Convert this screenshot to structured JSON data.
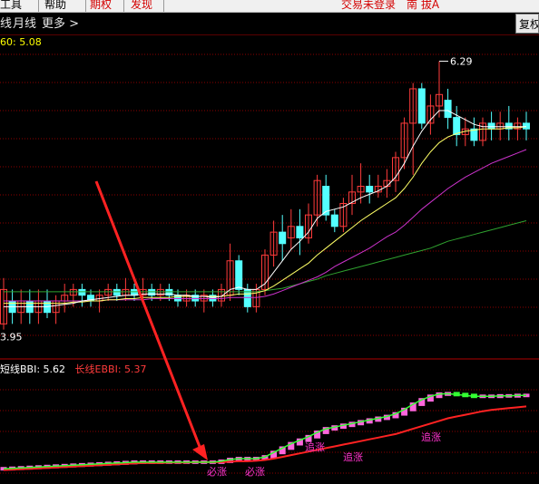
{
  "menu": {
    "items": [
      "工具",
      "帮助"
    ],
    "red_items": [
      "期权",
      "发现"
    ],
    "status_text": "交易未登录",
    "broker": "南 拔A"
  },
  "tabs": {
    "items": [
      "月线",
      "更多 >"
    ],
    "right_button": "复权"
  },
  "main_chart": {
    "ma_label": "60: 5.08",
    "high_label": "6.29",
    "low_label": "3.95"
  },
  "sub_chart": {
    "short_label": "短线BBI: 5.62",
    "long_label": "长线EBBI: 5.37"
  },
  "signals": [
    "必涨",
    "必涨",
    "追涨",
    "追涨",
    "追涨"
  ],
  "colors": {
    "background": "#000000",
    "grid": "#8b0000",
    "up_candle": "#ff3b3b",
    "down_candle": "#54ffff",
    "ma_fast": "#ffffff",
    "ma_mid": "#ffff66",
    "ma_slow": "#cc33cc",
    "ma_long": "#2fa22f",
    "arrow": "#ff2222",
    "signal_text": "#ff33cc"
  },
  "chart_data": {
    "type": "candlestick",
    "y_axis_unit": "price",
    "high_marker": 6.29,
    "low_marker": 3.95,
    "candles": [
      [
        4.0,
        4.3,
        3.95,
        4.4
      ],
      [
        4.2,
        4.1,
        4.0,
        4.3
      ],
      [
        4.1,
        4.2,
        4.0,
        4.3
      ],
      [
        4.2,
        4.1,
        4.0,
        4.3
      ],
      [
        4.1,
        4.2,
        4.0,
        4.3
      ],
      [
        4.2,
        4.1,
        4.05,
        4.3
      ],
      [
        4.1,
        4.2,
        4.0,
        4.25
      ],
      [
        4.2,
        4.25,
        4.1,
        4.35
      ],
      [
        4.25,
        4.3,
        4.15,
        4.35
      ],
      [
        4.3,
        4.25,
        4.15,
        4.35
      ],
      [
        4.25,
        4.2,
        4.15,
        4.3
      ],
      [
        4.2,
        4.25,
        4.1,
        4.3
      ],
      [
        4.25,
        4.3,
        4.2,
        4.35
      ],
      [
        4.3,
        4.25,
        4.2,
        4.35
      ],
      [
        4.25,
        4.3,
        4.2,
        4.4
      ],
      [
        4.3,
        4.25,
        4.2,
        4.35
      ],
      [
        4.25,
        4.3,
        4.2,
        4.4
      ],
      [
        4.3,
        4.25,
        4.2,
        4.35
      ],
      [
        4.25,
        4.3,
        4.2,
        4.35
      ],
      [
        4.3,
        4.25,
        4.2,
        4.35
      ],
      [
        4.25,
        4.2,
        4.15,
        4.3
      ],
      [
        4.2,
        4.25,
        4.15,
        4.3
      ],
      [
        4.25,
        4.2,
        4.15,
        4.3
      ],
      [
        4.2,
        4.25,
        4.1,
        4.3
      ],
      [
        4.25,
        4.2,
        4.15,
        4.3
      ],
      [
        4.2,
        4.3,
        4.15,
        4.35
      ],
      [
        4.25,
        4.55,
        4.2,
        4.7
      ],
      [
        4.55,
        4.3,
        4.25,
        4.6
      ],
      [
        4.3,
        4.15,
        4.1,
        4.35
      ],
      [
        4.15,
        4.3,
        4.1,
        4.35
      ],
      [
        4.3,
        4.6,
        4.25,
        4.65
      ],
      [
        4.6,
        4.8,
        4.5,
        4.9
      ],
      [
        4.8,
        4.7,
        4.55,
        4.95
      ],
      [
        4.75,
        4.85,
        4.65,
        5.0
      ],
      [
        4.85,
        4.75,
        4.6,
        5.0
      ],
      [
        4.75,
        4.95,
        4.7,
        5.05
      ],
      [
        4.95,
        5.25,
        4.85,
        5.3
      ],
      [
        5.2,
        4.95,
        4.9,
        5.3
      ],
      [
        4.95,
        4.85,
        4.8,
        5.0
      ],
      [
        4.85,
        5.05,
        4.8,
        5.1
      ],
      [
        5.05,
        5.15,
        4.95,
        5.3
      ],
      [
        5.15,
        5.2,
        5.05,
        5.4
      ],
      [
        5.2,
        5.15,
        5.05,
        5.3
      ],
      [
        5.15,
        5.2,
        5.1,
        5.3
      ],
      [
        5.2,
        5.25,
        5.1,
        5.35
      ],
      [
        5.25,
        5.45,
        5.15,
        5.5
      ],
      [
        5.45,
        5.75,
        5.35,
        5.8
      ],
      [
        5.75,
        6.05,
        5.3,
        6.1
      ],
      [
        6.05,
        5.75,
        5.7,
        6.1
      ],
      [
        5.75,
        5.9,
        5.65,
        6.0
      ],
      [
        5.9,
        6.0,
        5.8,
        6.29
      ],
      [
        5.95,
        5.8,
        5.7,
        6.05
      ],
      [
        5.8,
        5.65,
        5.55,
        5.9
      ],
      [
        5.65,
        5.7,
        5.55,
        5.8
      ],
      [
        5.7,
        5.6,
        5.55,
        5.8
      ],
      [
        5.6,
        5.75,
        5.55,
        5.8
      ],
      [
        5.75,
        5.7,
        5.6,
        5.85
      ],
      [
        5.7,
        5.75,
        5.6,
        5.85
      ],
      [
        5.75,
        5.7,
        5.6,
        5.9
      ],
      [
        5.7,
        5.75,
        5.6,
        5.8
      ],
      [
        5.75,
        5.7,
        5.6,
        5.85
      ]
    ],
    "ma_fast": [
      4.15,
      4.15,
      4.15,
      4.15,
      4.15,
      4.15,
      4.16,
      4.17,
      4.18,
      4.2,
      4.21,
      4.22,
      4.23,
      4.24,
      4.25,
      4.25,
      4.26,
      4.26,
      4.26,
      4.26,
      4.25,
      4.25,
      4.24,
      4.24,
      4.23,
      4.24,
      4.3,
      4.32,
      4.3,
      4.3,
      4.35,
      4.45,
      4.55,
      4.65,
      4.72,
      4.8,
      4.92,
      4.98,
      5.0,
      5.02,
      5.06,
      5.1,
      5.13,
      5.16,
      5.2,
      5.28,
      5.4,
      5.55,
      5.68,
      5.78,
      5.86,
      5.86,
      5.82,
      5.78,
      5.74,
      5.72,
      5.72,
      5.72,
      5.72,
      5.72,
      5.72
    ],
    "ma_mid": [
      4.18,
      4.18,
      4.18,
      4.18,
      4.18,
      4.18,
      4.18,
      4.18,
      4.19,
      4.19,
      4.2,
      4.2,
      4.21,
      4.21,
      4.22,
      4.22,
      4.23,
      4.23,
      4.23,
      4.23,
      4.24,
      4.24,
      4.24,
      4.24,
      4.24,
      4.24,
      4.25,
      4.26,
      4.26,
      4.27,
      4.29,
      4.33,
      4.38,
      4.43,
      4.48,
      4.53,
      4.6,
      4.66,
      4.72,
      4.78,
      4.84,
      4.9,
      4.95,
      5.0,
      5.05,
      5.1,
      5.18,
      5.28,
      5.4,
      5.5,
      5.58,
      5.63,
      5.66,
      5.68,
      5.69,
      5.7,
      5.7,
      5.7,
      5.71,
      5.71,
      5.72
    ],
    "ma_slow": [
      4.2,
      4.2,
      4.2,
      4.2,
      4.2,
      4.2,
      4.2,
      4.2,
      4.2,
      4.2,
      4.2,
      4.2,
      4.21,
      4.21,
      4.21,
      4.21,
      4.21,
      4.22,
      4.22,
      4.22,
      4.22,
      4.22,
      4.22,
      4.22,
      4.22,
      4.22,
      4.23,
      4.23,
      4.23,
      4.23,
      4.24,
      4.26,
      4.29,
      4.32,
      4.35,
      4.38,
      4.41,
      4.45,
      4.5,
      4.54,
      4.58,
      4.62,
      4.66,
      4.71,
      4.76,
      4.8,
      4.86,
      4.93,
      5.0,
      5.06,
      5.12,
      5.18,
      5.23,
      5.28,
      5.32,
      5.36,
      5.4,
      5.43,
      5.46,
      5.49,
      5.52
    ],
    "ma_long": [
      4.28,
      4.28,
      4.28,
      4.28,
      4.28,
      4.28,
      4.28,
      4.28,
      4.28,
      4.28,
      4.28,
      4.28,
      4.28,
      4.28,
      4.28,
      4.28,
      4.28,
      4.28,
      4.28,
      4.28,
      4.28,
      4.28,
      4.28,
      4.28,
      4.28,
      4.28,
      4.28,
      4.28,
      4.28,
      4.28,
      4.29,
      4.3,
      4.31,
      4.33,
      4.35,
      4.37,
      4.39,
      4.42,
      4.44,
      4.46,
      4.48,
      4.5,
      4.52,
      4.54,
      4.56,
      4.58,
      4.6,
      4.62,
      4.64,
      4.66,
      4.69,
      4.72,
      4.74,
      4.76,
      4.78,
      4.8,
      4.82,
      4.84,
      4.86,
      4.88,
      4.9
    ],
    "bbi_short": [
      3.95,
      3.96,
      3.97,
      3.98,
      3.99,
      4.0,
      4.01,
      4.02,
      4.03,
      4.04,
      4.05,
      4.06,
      4.07,
      4.08,
      4.09,
      4.1,
      4.1,
      4.1,
      4.1,
      4.1,
      4.1,
      4.1,
      4.1,
      4.1,
      4.1,
      4.12,
      4.16,
      4.18,
      4.18,
      4.18,
      4.22,
      4.32,
      4.42,
      4.52,
      4.6,
      4.68,
      4.78,
      4.86,
      4.9,
      4.94,
      4.98,
      5.02,
      5.06,
      5.1,
      5.14,
      5.2,
      5.3,
      5.42,
      5.52,
      5.6,
      5.65,
      5.66,
      5.64,
      5.62,
      5.6,
      5.6,
      5.6,
      5.61,
      5.61,
      5.62,
      5.62
    ],
    "bbi_long": [
      3.92,
      3.93,
      3.94,
      3.95,
      3.96,
      3.97,
      3.98,
      3.99,
      4.0,
      4.01,
      4.02,
      4.03,
      4.04,
      4.05,
      4.06,
      4.07,
      4.08,
      4.08,
      4.08,
      4.09,
      4.09,
      4.09,
      4.1,
      4.1,
      4.1,
      4.1,
      4.11,
      4.12,
      4.12,
      4.13,
      4.15,
      4.18,
      4.22,
      4.26,
      4.3,
      4.34,
      4.38,
      4.42,
      4.46,
      4.5,
      4.54,
      4.58,
      4.62,
      4.66,
      4.7,
      4.74,
      4.8,
      4.86,
      4.92,
      4.98,
      5.04,
      5.1,
      5.14,
      5.18,
      5.22,
      5.26,
      5.29,
      5.31,
      5.33,
      5.35,
      5.37
    ],
    "signal_candle_index": [
      23,
      27,
      34,
      38,
      47
    ]
  }
}
